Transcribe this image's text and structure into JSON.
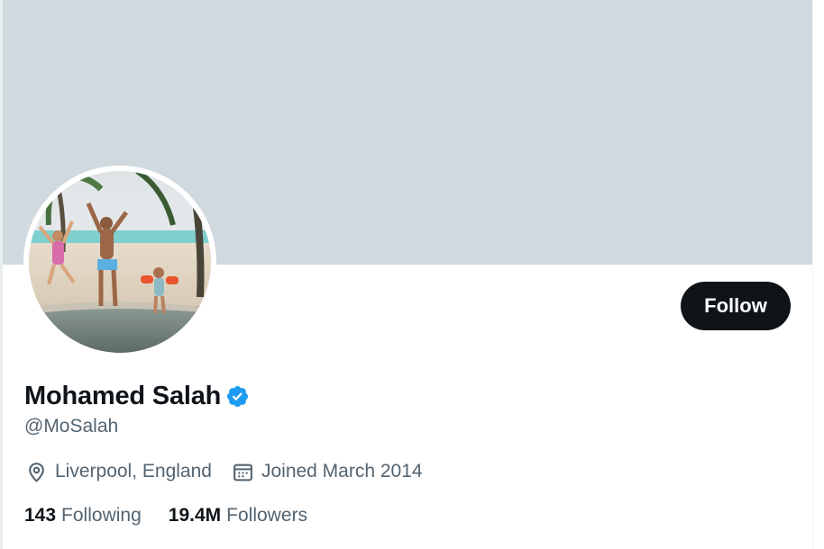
{
  "profile": {
    "display_name": "Mohamed Salah",
    "handle": "@MoSalah",
    "location": "Liverpool, England",
    "joined": "Joined March 2014",
    "verified_icon": "verified-badge-icon"
  },
  "actions": {
    "follow_label": "Follow"
  },
  "stats": {
    "following_count": "143",
    "following_label": "Following",
    "followers_count": "19.4M",
    "followers_label": "Followers"
  },
  "colors": {
    "banner": "#cfd9de",
    "primary_text": "#0f1419",
    "secondary_text": "#536471",
    "verified_blue": "#1d9bf0",
    "follow_button": "#0f1419"
  }
}
